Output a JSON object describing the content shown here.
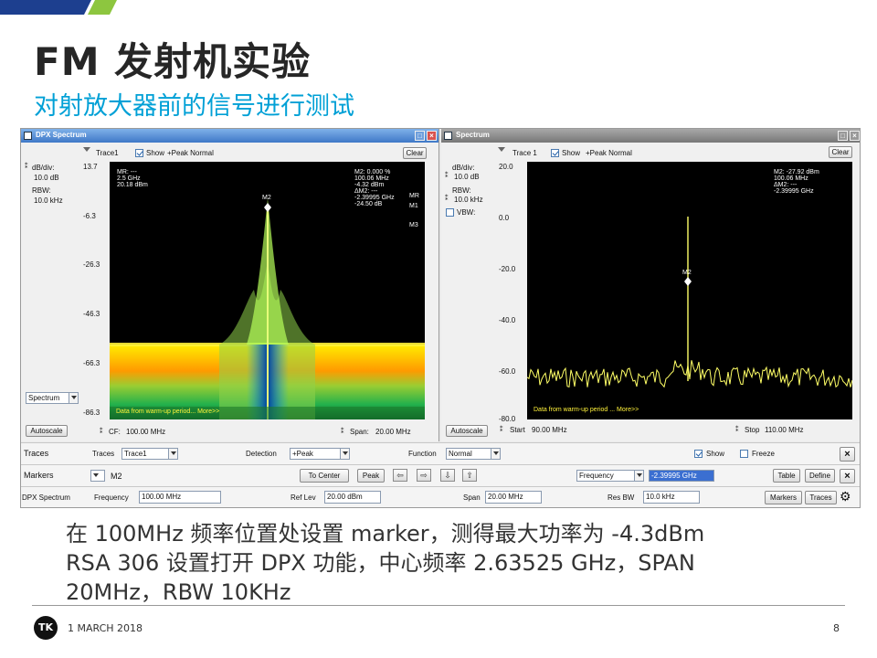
{
  "slide": {
    "title": "FM 发射机实验",
    "subtitle": "对射放大器前的信号进行测试",
    "body_lines": [
      "在 100MHz 频率位置处设置 marker，测得最大功率为 -4.3dBm",
      "RSA 306 设置打开 DPX 功能，中心频率 2.63525 GHz，SPAN",
      "20MHz，RBW 10KHz"
    ],
    "footer_date": "1 MARCH 2018",
    "page_number": "8",
    "logo_text": "TK"
  },
  "dpx_window": {
    "title": "DPX Spectrum",
    "trace_label": "Trace1",
    "show_label": "Show",
    "trace_mode": "+Peak Normal",
    "clear_label": "Clear",
    "db_div_label": "dB/div:",
    "db_div_value": "10.0 dB",
    "rbw_label": "RBW:",
    "rbw_value": "10.0 kHz",
    "y_ticks": [
      "13.7",
      "-6.3",
      "-26.3",
      "-46.3",
      "-66.3",
      "-86.3"
    ],
    "mr_readout": [
      "MR: ---",
      "2.5 GHz",
      "20.18 dBm"
    ],
    "m2_readout": [
      "M2: 0.000 %",
      "100.06 MHz",
      "-4.32 dBm",
      "ΔM2: ---",
      "-2.39995 GHz",
      "-24.50 dB"
    ],
    "marker_tabs": [
      "MR",
      "M1",
      "M3"
    ],
    "marker_label": "M2",
    "warmup_text": "Data from warm-up period... More>>",
    "display_select": "Spectrum",
    "autoscale_label": "Autoscale",
    "cf_label": "CF:",
    "cf_value": "100.00 MHz",
    "span_label": "Span:",
    "span_value": "20.00 MHz"
  },
  "spectrum_window": {
    "title": "Spectrum",
    "trace_label": "Trace 1",
    "show_label": "Show",
    "trace_mode": "+Peak Normal",
    "clear_label": "Clear",
    "db_div_label": "dB/div:",
    "db_div_value": "10.0 dB",
    "rbw_label": "RBW:",
    "rbw_value": "10.0 kHz",
    "vbw_label": "VBW:",
    "y_ticks": [
      "20.0",
      "0.0",
      "-20.0",
      "-40.0",
      "-60.0",
      "-80.0"
    ],
    "m2_readout": [
      "M2: -27.92 dBm",
      "100.06 MHz",
      "ΔM2: ---",
      "-2.39995 GHz"
    ],
    "marker_label": "M2",
    "warmup_text": "Data from warm-up period ... More>>",
    "autoscale_label": "Autoscale",
    "start_label": "Start",
    "start_value": "90.00 MHz",
    "stop_label": "Stop",
    "stop_value": "110.00 MHz"
  },
  "controls": {
    "traces_row": {
      "heading": "Traces",
      "traces_label": "Traces",
      "traces_value": "Trace1",
      "detection_label": "Detection",
      "detection_value": "+Peak",
      "function_label": "Function",
      "function_value": "Normal",
      "show_label": "Show",
      "freeze_label": "Freeze"
    },
    "markers_row": {
      "heading": "Markers",
      "marker_value": "M2",
      "to_center_label": "To Center",
      "peak_label": "Peak",
      "readout_select": "Frequency",
      "readout_value": "-2.39995 GHz",
      "table_label": "Table",
      "define_label": "Define"
    },
    "dpx_row": {
      "heading": "DPX Spectrum",
      "frequency_label": "Frequency",
      "frequency_value": "100.00 MHz",
      "ref_lev_label": "Ref Lev",
      "ref_lev_value": "20.00 dBm",
      "span_label": "Span",
      "span_value": "20.00 MHz",
      "res_bw_label": "Res BW",
      "res_bw_value": "10.0 kHz",
      "markers_btn": "Markers",
      "traces_btn": "Traces"
    }
  },
  "colors": {
    "accent": "#00a0d6",
    "title": "#262626",
    "trace_yellow": "#ffff66",
    "plot_bg": "#000000"
  }
}
